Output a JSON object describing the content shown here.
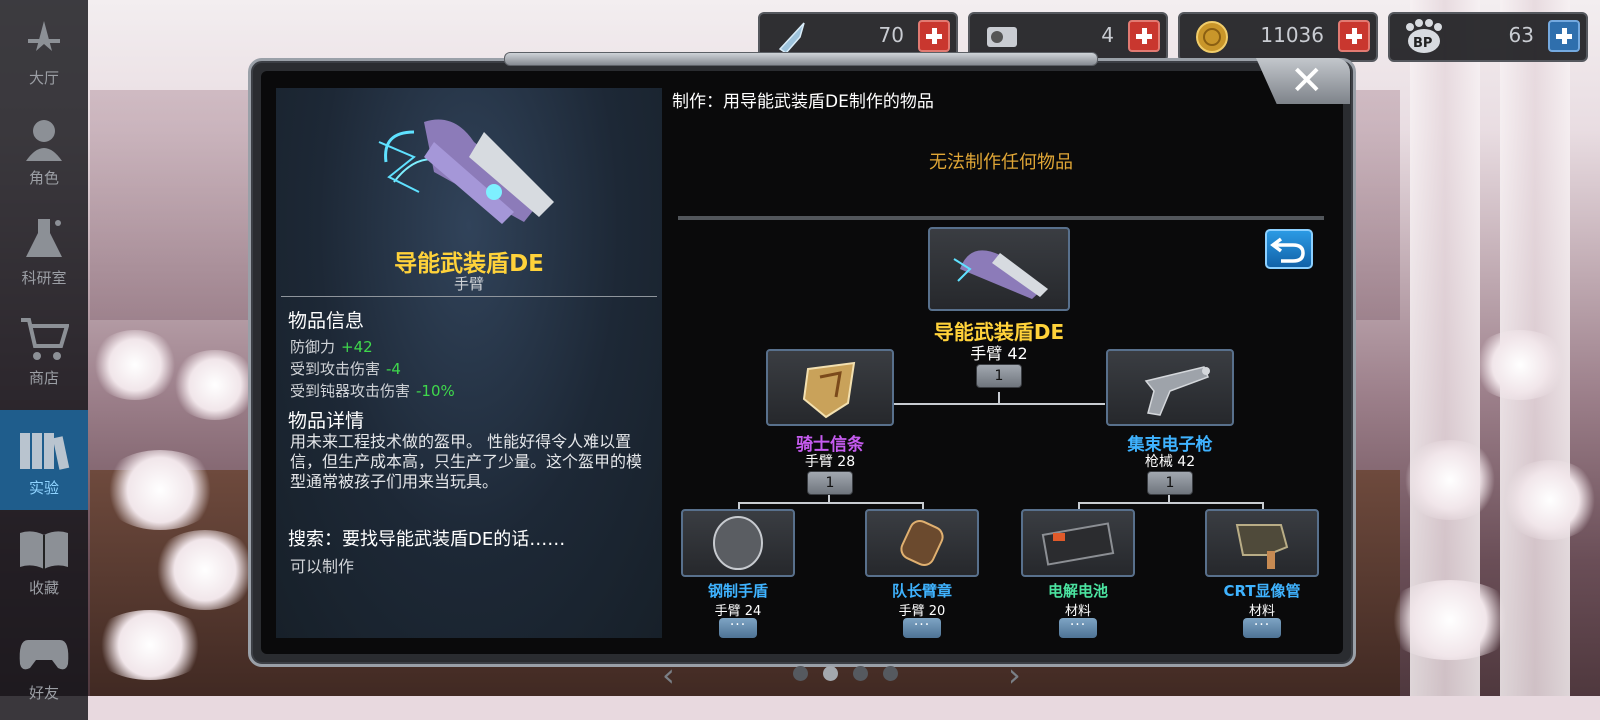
{
  "currencies": [
    {
      "icon": "diamond-icon",
      "value": "70",
      "add": "plus-icon"
    },
    {
      "icon": "drive-icon",
      "value": "4",
      "add": "plus-icon"
    },
    {
      "icon": "coin-icon",
      "value": "11036",
      "add": "plus-icon"
    },
    {
      "icon": "bp-icon",
      "value": "63",
      "add": "card-icon"
    }
  ],
  "sidebar": {
    "items": [
      {
        "label": "大厅",
        "icon": "hall-icon"
      },
      {
        "label": "角色",
        "icon": "character-icon"
      },
      {
        "label": "科研室",
        "icon": "flask-icon"
      },
      {
        "label": "商店",
        "icon": "cart-icon"
      },
      {
        "label": "实验",
        "icon": "books-icon",
        "active": true
      },
      {
        "label": "收藏",
        "icon": "book-icon"
      },
      {
        "label": "好友",
        "icon": "gamepad-icon"
      }
    ]
  },
  "item": {
    "name": "导能武装盾DE",
    "type": "手臂",
    "info_heading": "物品信息",
    "stats": [
      {
        "label": "防御力",
        "value": "+42"
      },
      {
        "label": "受到攻击伤害",
        "value": "-4"
      },
      {
        "label": "受到钝器攻击伤害",
        "value": "-10%"
      }
    ],
    "details_heading": "物品详情",
    "description": "用未来工程技术做的盔甲。 性能好得令人难以置信，但生产成本高，只生产了少量。这个盔甲的模型通常被孩子们用来当玩具。",
    "search_heading": "搜索：要找导能武装盾DE的话……",
    "search_result": "可以制作"
  },
  "crafting": {
    "title": "制作：用导能武装盾DE制作的物品",
    "empty_message": "无法制作任何物品",
    "root": {
      "name": "导能武装盾DE",
      "sub": "手臂 42",
      "qty": "1"
    },
    "left": {
      "name": "骑士信条",
      "sub": "手臂 28",
      "qty": "1",
      "color": "#c65bf0"
    },
    "right": {
      "name": "集束电子枪",
      "sub": "枪械 42",
      "qty": "1",
      "color": "#3fb3ff"
    },
    "leaves": [
      {
        "name": "钢制手盾",
        "sub": "手臂 24",
        "more": "···",
        "color": "#3fb3ff"
      },
      {
        "name": "队长臂章",
        "sub": "手臂 20",
        "more": "···",
        "color": "#3fb3ff"
      },
      {
        "name": "电解电池",
        "sub": "材料",
        "more": "···",
        "color": "#4be3a0"
      },
      {
        "name": "CRT显像管",
        "sub": "材料",
        "more": "···",
        "color": "#3fb3ff"
      }
    ]
  },
  "pager": {
    "pages": 4,
    "current": 2
  }
}
